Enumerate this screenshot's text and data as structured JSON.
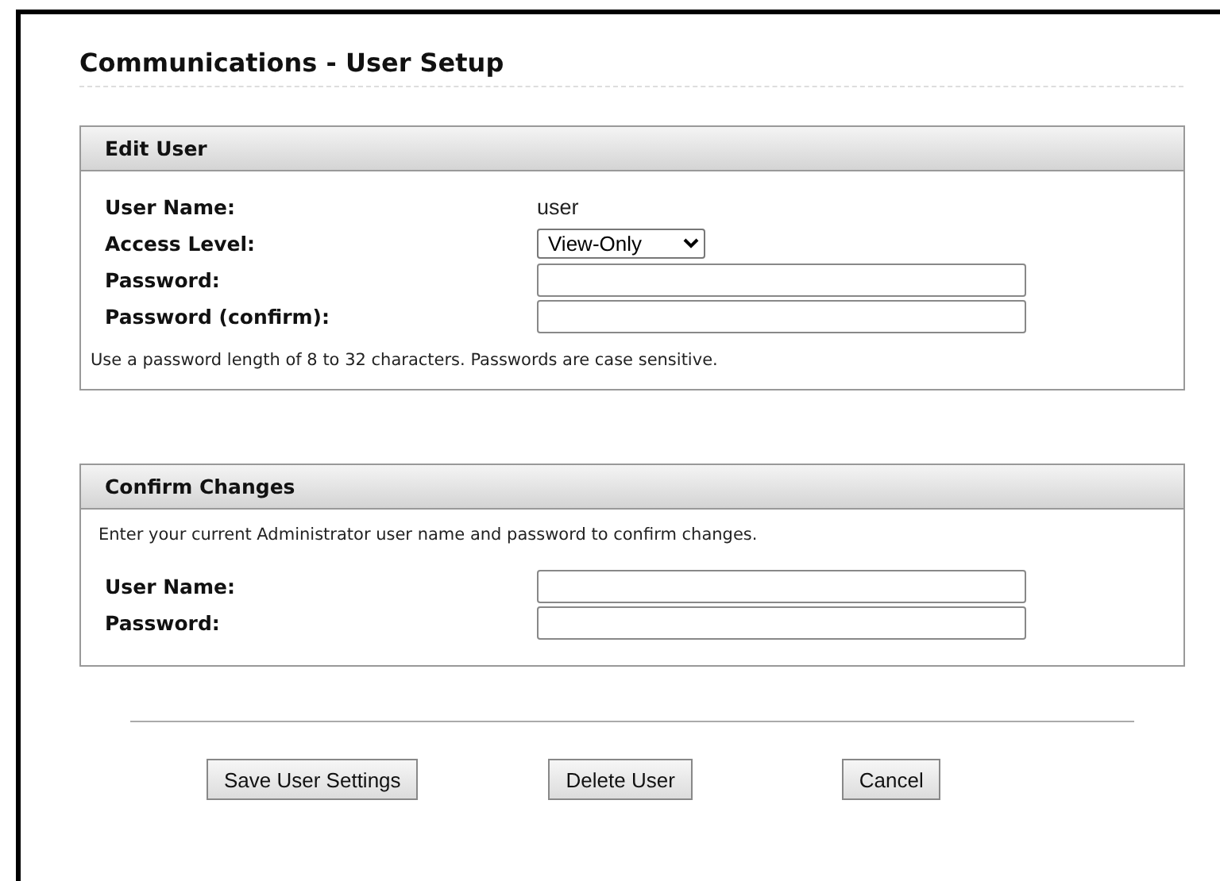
{
  "page_title": "Communications - User Setup",
  "edit_user": {
    "title": "Edit User",
    "rows": [
      {
        "kind": "text",
        "label": "User Name:",
        "value": "user"
      },
      {
        "kind": "select",
        "label": "Access Level:",
        "value": "View-Only"
      },
      {
        "kind": "input",
        "label": "Password:"
      },
      {
        "kind": "input",
        "label": "Password (confirm):"
      }
    ],
    "note": "Use a password length of 8 to 32 characters. Passwords are case sensitive."
  },
  "confirm_changes": {
    "title": "Confirm Changes",
    "note": "Enter your current Administrator user name and password to confirm changes.",
    "rows": [
      {
        "kind": "input",
        "label": "User Name:"
      },
      {
        "kind": "input",
        "label": "Password:"
      }
    ]
  },
  "buttons": [
    "Save User Settings",
    "Delete User",
    "Cancel"
  ]
}
